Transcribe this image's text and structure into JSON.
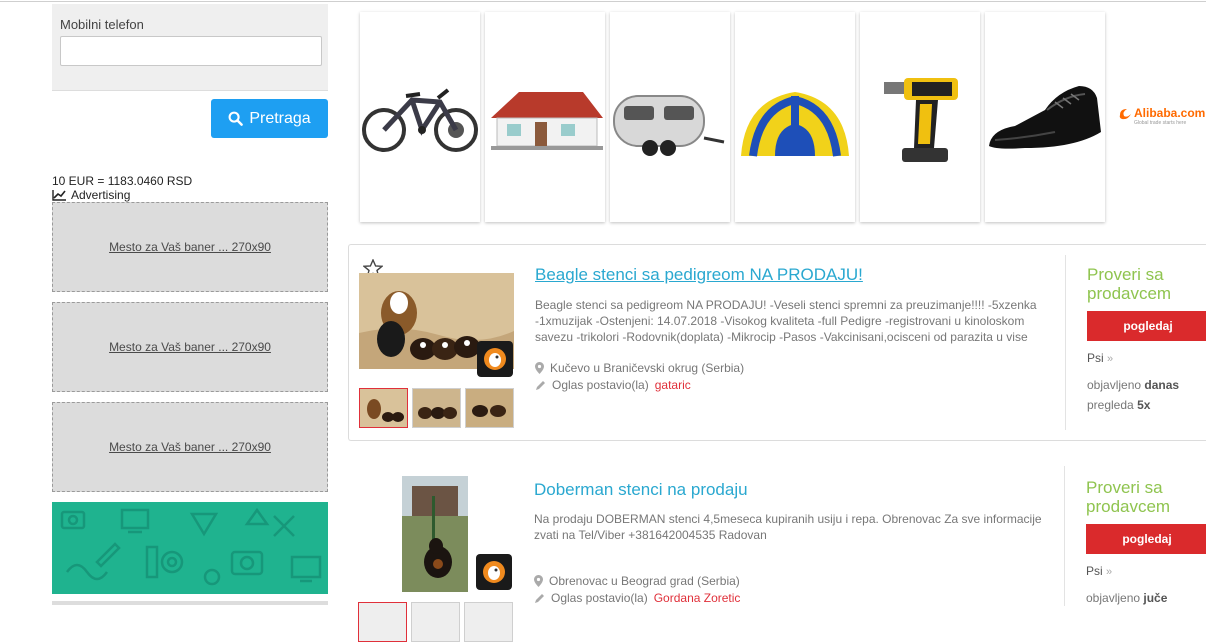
{
  "filter": {
    "phone_label": "Mobilni telefon",
    "phone_value": "",
    "search_button": "Pretraga"
  },
  "currency_rate": "10 EUR = 1183.0460 RSD",
  "advertising_label": "Advertising",
  "banners": [
    {
      "label": "Mesto za Vaš baner ... 270x90"
    },
    {
      "label": "Mesto za Vaš baner ... 270x90"
    },
    {
      "label": "Mesto za Vaš baner ... 270x90"
    }
  ],
  "product_strip": {
    "items": [
      "bicycle",
      "prefab-house",
      "camper-trailer",
      "inflatable-tent",
      "impact-drill",
      "leather-shoe"
    ],
    "partner_logo": "Alibaba.com",
    "partner_tagline": "Global trade starts here"
  },
  "listings": [
    {
      "title": "Beagle stenci sa pedigreom NA PRODAJU!",
      "description": "Beagle stenci sa pedigreom NA PRODAJU! -Veseli stenci spremni za preuzimanje!!!! -5xzenka -1xmuzijak -Ostenjeni: 14.07.2018 -Visokog kvaliteta -full Pedigre -registrovani u kinoloskom savezu -trikolori -Rodovnik(doplata) -Mikrocip -Pasos -Vakcinisani,ocisceni od parazita u vise",
      "location": "Kučevo u Braničevski okrug (Serbia)",
      "posted_by_label": "Oglas postavio(la)",
      "posted_by": "gataric",
      "contact_label": "Proveri sa prodavcem",
      "view_button": "pogledaj",
      "category": "Psi",
      "published_label": "objavljeno",
      "published_value": "danas",
      "views_label": "pregleda",
      "views_value": "5x"
    },
    {
      "title": "Doberman stenci na prodaju",
      "description": "Na prodaju DOBERMAN stenci 4,5meseca kupiranih usiju i repa. Obrenovac Za sve informacije zvati na Tel/Viber +381642004535 Radovan",
      "location": "Obrenovac u Beograd grad (Serbia)",
      "posted_by_label": "Oglas postavio(la)",
      "posted_by": "Gordana Zoretic",
      "contact_label": "Proveri sa prodavcem",
      "view_button": "pogledaj",
      "category": "Psi",
      "published_label": "objavljeno",
      "published_value": "juče"
    }
  ],
  "colors": {
    "accent_blue": "#1e9ff2",
    "link_blue": "#2aa8d0",
    "contact_green": "#8fc44f",
    "button_red": "#da2a2c",
    "banner_teal": "#1fb38f"
  }
}
